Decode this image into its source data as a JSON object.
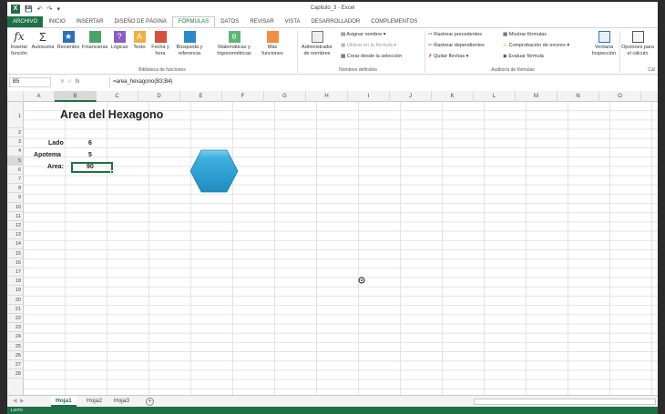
{
  "window": {
    "title": "Capitulo_3 - Excel",
    "quick_access": [
      "save",
      "undo",
      "redo",
      "customize"
    ]
  },
  "ribbon_tabs": [
    "ARCHIVO",
    "INICIO",
    "INSERTAR",
    "DISEÑO DE PÁGINA",
    "FÓRMULAS",
    "DATOS",
    "REVISAR",
    "VISTA",
    "DESARROLLADOR",
    "COMPLEMENTOS"
  ],
  "active_tab": "FÓRMULAS",
  "ribbon": {
    "insert_function": "Insertar función",
    "autosum": "Autosuma",
    "recent": "Recientes",
    "financial": "Financieras",
    "logical": "Lógicas",
    "text": "Texto",
    "datetime": "Fecha y hora",
    "lookup": "Búsqueda y referencia",
    "math": "Matemáticas y trigonométricas",
    "more": "Más funciones",
    "library_label": "Biblioteca de funciones",
    "name_manager": "Administrador de nombres",
    "define_name": "Asignar nombre",
    "use_in_formula": "Utilizar en la fórmula",
    "create_from_selection": "Crear desde la selección",
    "defined_names_label": "Nombres definidos",
    "trace_precedents": "Rastrear precedentes",
    "trace_dependents": "Rastrear dependientes",
    "remove_arrows": "Quitar flechas",
    "show_formulas": "Mostrar fórmulas",
    "error_checking": "Comprobación de errores",
    "evaluate_formula": "Evaluar fórmula",
    "auditing_label": "Auditoría de fórmulas",
    "watch_window": "Ventana Inspección",
    "calc_options": "Opciones para el cálculo",
    "calc_label": "Cál"
  },
  "formula_bar": {
    "name_box": "B5",
    "formula": "=area_hexagono(B3;B4)"
  },
  "columns": [
    "A",
    "B",
    "C",
    "D",
    "E",
    "F",
    "G",
    "H",
    "I",
    "J",
    "K",
    "L",
    "M",
    "N",
    "O"
  ],
  "selected_column": "B",
  "rows": [
    "1",
    "2",
    "3",
    "4",
    "5",
    "6",
    "7",
    "8",
    "9",
    "10",
    "11",
    "12",
    "13",
    "14",
    "15",
    "16",
    "17",
    "18",
    "19",
    "20",
    "21",
    "22",
    "23",
    "24",
    "25",
    "26",
    "27",
    "28"
  ],
  "selected_row": "5",
  "sheet": {
    "title": "Area del Hexagono",
    "labels": {
      "lado": "Lado",
      "apotema": "Apotema",
      "area": "Area:"
    },
    "values": {
      "lado": "6",
      "apotema": "5",
      "area": "90"
    }
  },
  "sheet_tabs": [
    "Hoja1",
    "Hoja2",
    "Hoja3"
  ],
  "active_sheet": "Hoja1",
  "status": {
    "text": "LISTO"
  },
  "colors": {
    "accent": "#1e7145",
    "hexagon_fill": "#2e9fd6",
    "hexagon_top": "#7fd0f0"
  }
}
